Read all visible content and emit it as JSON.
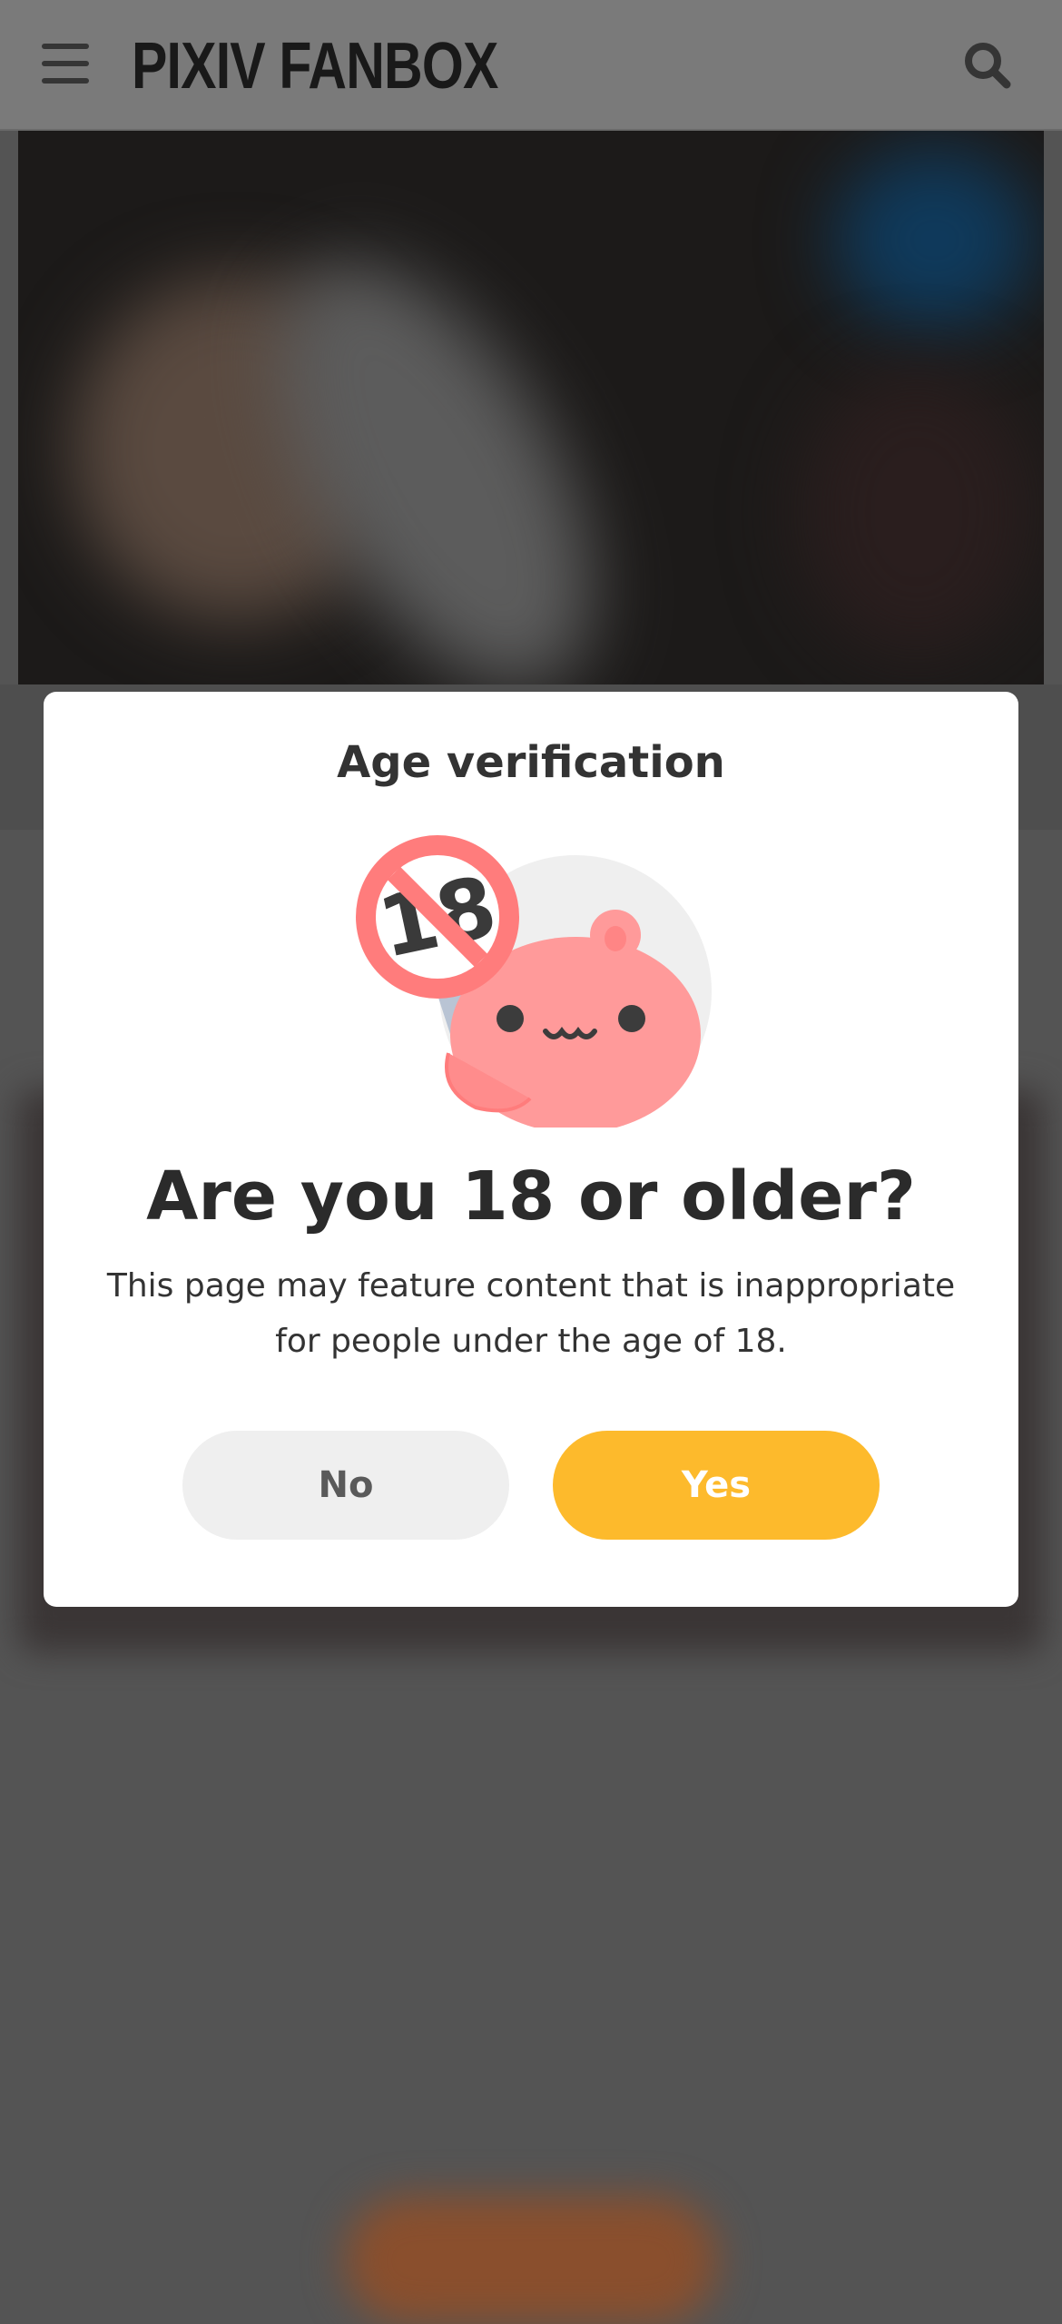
{
  "header": {
    "logo_text": "PIXIV FANBOX",
    "menu_icon": "hamburger-menu-icon",
    "search_icon": "search-icon"
  },
  "modal": {
    "title": "Age verification",
    "illustration": "age-restriction-mascot-icon",
    "question": "Are you 18 or older?",
    "description": "This page may feature content that is inappropriate for people under the age of 18.",
    "no_label": "No",
    "yes_label": "Yes"
  },
  "colors": {
    "overlay": "#545454",
    "header": "#7a7a7a",
    "yes_button": "#fdba2c",
    "no_button": "#efefef",
    "mascot": "#ff8a8a"
  }
}
